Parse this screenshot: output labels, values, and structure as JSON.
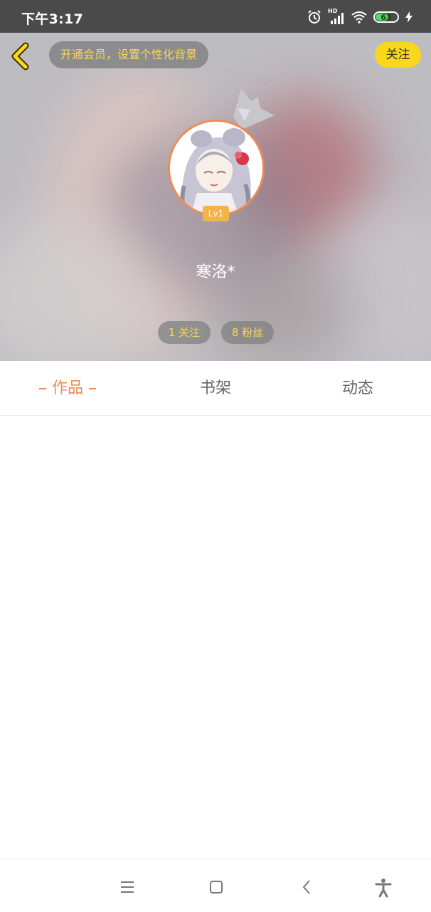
{
  "status_bar": {
    "time": "下午3:17",
    "network": "HD",
    "battery_level": "63",
    "battery_fraction": 0.63,
    "icons": [
      "alarm-icon",
      "signal-icon",
      "wifi-icon",
      "battery-icon",
      "charging-icon"
    ]
  },
  "header": {
    "vip_banner": "开通会员，设置个性化背景",
    "follow_label": "关注",
    "icons": [
      "back-arrow-icon",
      "crown-icon"
    ]
  },
  "profile": {
    "level": "Lv1",
    "username": "寒洛*",
    "following": "1 关注",
    "followers": "8 粉丝"
  },
  "tabs": {
    "works": "作品",
    "bookshelf": "书架",
    "activity": "动态"
  },
  "nav_bar": {
    "icons": [
      "menu-icon",
      "home-icon",
      "back-icon",
      "accessibility-icon"
    ]
  },
  "colors": {
    "accent": "#ee8b55",
    "vip_text": "#f7d85a",
    "follow_button": "#f9d71c",
    "status_bar": "#4a4a4a",
    "battery": "#4cd964"
  }
}
